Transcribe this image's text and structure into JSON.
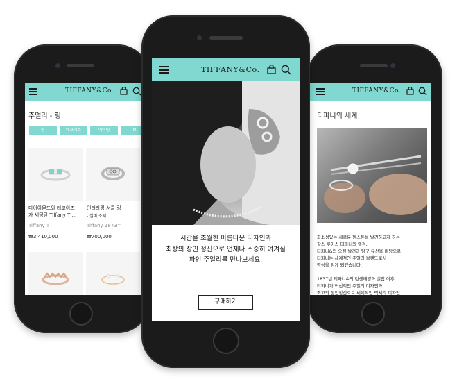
{
  "left": {
    "logo": "TIFFANY&Co.",
    "page_title": "주얼리 - 링",
    "filters": [
      "링",
      "네크리스",
      "이어링",
      "브"
    ],
    "products": [
      {
        "name1": "다이아몬드와 터코이즈",
        "name2": "가 세팅된 Tiffany T ...",
        "collection": "Tiffany T",
        "price": "₩3,410,000"
      },
      {
        "name1": "인터라킹 서클 링",
        "name2": "- 실버 소재",
        "collection": "Tiffany 1873™",
        "price": "₩700,000"
      }
    ]
  },
  "center": {
    "logo": "TIFFANY&Co.",
    "hero_line1": "시간을 초월한 아름다운 디자인과",
    "hero_line2": "최상의 장인 정신으로 언제나 소중히 여겨질",
    "hero_line3": "파인 주얼리를 만나보세요.",
    "buy_button": "구매하기"
  },
  "right": {
    "logo": "TIFFANY&Co.",
    "page_title": "티파니의 세계",
    "para1": [
      "희소성있는 새로운 젬스톤을 발견하고자 하는",
      "찰스 루이스 티파니의 열정,",
      "티파니&의 오랜 발견과 탐구 유산을 바탕으로",
      "티파니는 세계적인 주얼리 브랜드로서",
      "명성을 얻게 되었습니다."
    ],
    "para2": [
      "1837년 티파니&의 탄생배경과 설립 이후",
      "티파니가 혁신적인 주얼리 디자인과",
      "최고의 장인정신으로 세계적인 럭셔리 디자인"
    ]
  },
  "colors": {
    "accent": "#81d8d0",
    "phone_body": "#1b1b1b"
  },
  "icons": [
    "menu-icon",
    "bag-icon",
    "search-icon"
  ]
}
